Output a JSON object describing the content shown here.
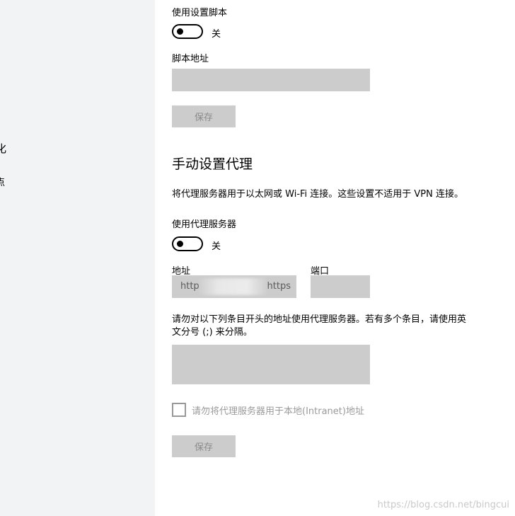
{
  "sidebar": {
    "fragments": [
      "化",
      "点"
    ]
  },
  "script_section": {
    "use_script_label": "使用设置脚本",
    "toggle_state": "关",
    "script_address_label": "脚本地址",
    "script_address_value": "",
    "save_label": "保存"
  },
  "manual_section": {
    "title": "手动设置代理",
    "description": "将代理服务器用于以太网或 Wi-Fi 连接。这些设置不适用于 VPN 连接。",
    "use_proxy_label": "使用代理服务器",
    "toggle_state": "关",
    "address_label": "地址",
    "address_value_left": "http",
    "address_value_right": "https",
    "port_label": "端口",
    "port_value": "",
    "exceptions_line1": "请勿对以下列条目开头的地址使用代理服务器。若有多个条目，请使用英",
    "exceptions_line2": "文分号 (;) 来分隔。",
    "exceptions_value": "",
    "local_checkbox_label": "请勿将代理服务器用于本地(Intranet)地址",
    "save_label": "保存"
  },
  "watermark": "https://blog.csdn.net/bingcui",
  "colors": {
    "sidebar_bg": "#f2f3f4",
    "field_bg": "#cccccc",
    "disabled_text": "#8a8a8a"
  }
}
